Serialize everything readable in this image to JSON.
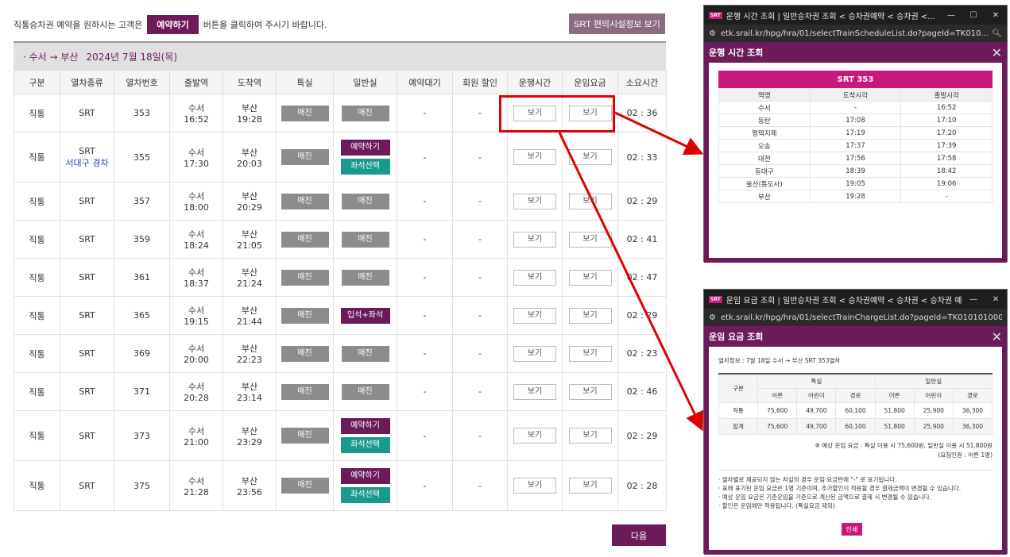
{
  "notice": {
    "before": "직통승차권 예약을 원하시는 고객은",
    "button": "예약하기",
    "after": "버튼을 클릭하여 주시기 바랍니다."
  },
  "facility_button": "SRT 편의시설정보 보기",
  "route": {
    "path": "· 수서 → 부산",
    "date": "2024년 7월 18일(목)"
  },
  "headers": [
    "구분",
    "열차종류",
    "열차번호",
    "출발역",
    "도착역",
    "특실",
    "일반실",
    "예약대기",
    "회원 할인",
    "운행시간",
    "운임요금",
    "소요시간"
  ],
  "rows": [
    {
      "type": "직통",
      "kind": "SRT",
      "sub": "",
      "no": "353",
      "dep_st": "수서",
      "dep_t": "16:52",
      "arr_st": "부산",
      "arr_t": "19:28",
      "first": "매진",
      "general": [
        "매진"
      ],
      "wait": "-",
      "discount": "-",
      "view1": "보기",
      "view2": "보기",
      "dur": "02 : 36"
    },
    {
      "type": "직통",
      "kind": "SRT",
      "sub": "서대구 경차",
      "no": "355",
      "dep_st": "수서",
      "dep_t": "17:30",
      "arr_st": "부산",
      "arr_t": "20:03",
      "first": "매진",
      "general": [
        "예약하기",
        "좌석선택"
      ],
      "wait": "-",
      "discount": "-",
      "view1": "보기",
      "view2": "보기",
      "dur": "02 : 33"
    },
    {
      "type": "직통",
      "kind": "SRT",
      "sub": "",
      "no": "357",
      "dep_st": "수서",
      "dep_t": "18:00",
      "arr_st": "부산",
      "arr_t": "20:29",
      "first": "매진",
      "general": [
        "매진"
      ],
      "wait": "-",
      "discount": "-",
      "view1": "보기",
      "view2": "보기",
      "dur": "02 : 29"
    },
    {
      "type": "직통",
      "kind": "SRT",
      "sub": "",
      "no": "359",
      "dep_st": "수서",
      "dep_t": "18:24",
      "arr_st": "부산",
      "arr_t": "21:05",
      "first": "매진",
      "general": [
        "매진"
      ],
      "wait": "-",
      "discount": "-",
      "view1": "보기",
      "view2": "보기",
      "dur": "02 : 41"
    },
    {
      "type": "직통",
      "kind": "SRT",
      "sub": "",
      "no": "361",
      "dep_st": "수서",
      "dep_t": "18:37",
      "arr_st": "부산",
      "arr_t": "21:24",
      "first": "매진",
      "general": [
        "매진"
      ],
      "wait": "-",
      "discount": "-",
      "view1": "보기",
      "view2": "보기",
      "dur": "02 : 47"
    },
    {
      "type": "직통",
      "kind": "SRT",
      "sub": "",
      "no": "365",
      "dep_st": "수서",
      "dep_t": "19:15",
      "arr_st": "부산",
      "arr_t": "21:44",
      "first": "매진",
      "general": [
        "입석+좌석"
      ],
      "wait": "-",
      "discount": "-",
      "view1": "보기",
      "view2": "보기",
      "dur": "02 : 29"
    },
    {
      "type": "직통",
      "kind": "SRT",
      "sub": "",
      "no": "369",
      "dep_st": "수서",
      "dep_t": "20:00",
      "arr_st": "부산",
      "arr_t": "22:23",
      "first": "매진",
      "general": [
        "매진"
      ],
      "wait": "-",
      "discount": "-",
      "view1": "보기",
      "view2": "보기",
      "dur": "02 : 23"
    },
    {
      "type": "직통",
      "kind": "SRT",
      "sub": "",
      "no": "371",
      "dep_st": "수서",
      "dep_t": "20:28",
      "arr_st": "부산",
      "arr_t": "23:14",
      "first": "매진",
      "general": [
        "매진"
      ],
      "wait": "-",
      "discount": "-",
      "view1": "보기",
      "view2": "보기",
      "dur": "02 : 46"
    },
    {
      "type": "직통",
      "kind": "SRT",
      "sub": "",
      "no": "373",
      "dep_st": "수서",
      "dep_t": "21:00",
      "arr_st": "부산",
      "arr_t": "23:29",
      "first": "매진",
      "general": [
        "예약하기",
        "좌석선택"
      ],
      "wait": "-",
      "discount": "-",
      "view1": "보기",
      "view2": "보기",
      "dur": "02 : 29"
    },
    {
      "type": "직통",
      "kind": "SRT",
      "sub": "",
      "no": "375",
      "dep_st": "수서",
      "dep_t": "21:28",
      "arr_st": "부산",
      "arr_t": "23:56",
      "first": "매진",
      "general": [
        "예약하기",
        "좌석선택"
      ],
      "wait": "-",
      "discount": "-",
      "view1": "보기",
      "view2": "보기",
      "dur": "02 : 28"
    }
  ],
  "next_button": "다음",
  "schedule_popup": {
    "window_title": "운행 시간 조회 | 일반승차권 조회 < 승차권예약 < 승차권 <...",
    "url": "etk.srail.kr/hpg/hra/01/selectTrainScheduleList.do?pageId=TK010...",
    "header": "운행 시간 조회",
    "train": "SRT 353",
    "columns": [
      "역명",
      "도착시각",
      "출발시각"
    ],
    "stops": [
      [
        "수서",
        "-",
        "16:52"
      ],
      [
        "동탄",
        "17:08",
        "17:10"
      ],
      [
        "평택지제",
        "17:19",
        "17:20"
      ],
      [
        "오송",
        "17:37",
        "17:39"
      ],
      [
        "대전",
        "17:56",
        "17:58"
      ],
      [
        "동대구",
        "18:39",
        "18:42"
      ],
      [
        "울산(통도사)",
        "19:05",
        "19:06"
      ],
      [
        "부산",
        "19:28",
        "-"
      ]
    ]
  },
  "fare_popup": {
    "window_title": "운임 요금 조회 | 일반승차권 조회 < 승차권예약 < 승차권 < 승차권 예약/발매 - 국민철...",
    "url": "etk.srail.kr/hpg/hra/01/selectTrainChargeList.do?pageId=TK0101010000&chtnDvCd=1&d...",
    "header": "운임 요금 조회",
    "info": "열차정보 : 7월 18일 수서 → 부산 SRT 353열차",
    "col_group": "구분",
    "first_class": "특실",
    "general_class": "일반실",
    "sub_cols": [
      "어른",
      "어린이",
      "경로",
      "어른",
      "어린이",
      "경로"
    ],
    "rows": [
      {
        "label": "직통",
        "values": [
          "75,600",
          "49,700",
          "60,100",
          "51,800",
          "25,900",
          "36,300"
        ]
      },
      {
        "label": "합계",
        "values": [
          "75,600",
          "49,700",
          "60,100",
          "51,800",
          "25,900",
          "36,300"
        ]
      }
    ],
    "summary_line1": "※ 예상 운임 요금 : 특실 이용 시 75,600원, 일반실 이용 시 51,800원",
    "summary_line2": "(요청인원 : 어른 1명)",
    "notes": [
      "· 열차별로 제공되지 않는 차실의 경우 운임 요금란에 \"-\" 로 표기됩니다.",
      "· 표에 표기된 운임 요금은 1명 기준이며, 추가할인이 적용될 경우 결제금액이 변경될 수 있습니다.",
      "· 예상 운임 요금은 기준운임을 기준으로 계산된 금액으로 결제 시 변경될 수 있습니다.",
      "· 할인은 운임에만 적용됩니다. (특실요금 제외)"
    ],
    "print_button": "인쇄"
  },
  "colors": {
    "brand": "#6d1a5b",
    "accent": "#c8187d",
    "seat": "#1a9a8e",
    "sold": "#8c8c8c",
    "annotation": "#e00000"
  }
}
